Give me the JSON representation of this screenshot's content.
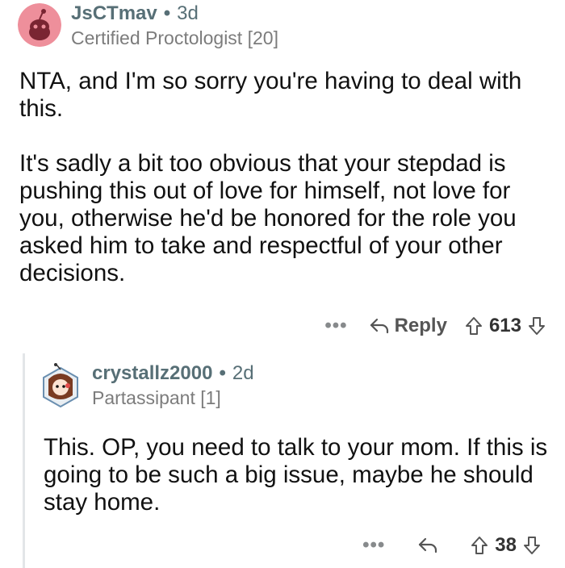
{
  "comments": [
    {
      "username": "JsCTmav",
      "age": "3d",
      "flair": "Certified Proctologist [20]",
      "paragraphs": [
        "NTA, and I'm so sorry you're having to deal with this.",
        "It's sadly a bit too obvious that your stepdad is pushing this out of love for himself, not love for you, otherwise he'd be honored for the role you asked him to take and respectful of your other decisions."
      ],
      "reply_label": "Reply",
      "score": "613"
    },
    {
      "username": "crystallz2000",
      "age": "2d",
      "flair": "Partassipant [1]",
      "paragraphs": [
        "This. OP, you need to talk to your mom. If this is going to be such a big issue, maybe he should stay home."
      ],
      "score": "38"
    }
  ],
  "separator": "•",
  "more_label": "•••",
  "colors": {
    "meta": "#576f76",
    "avatar1": "#ee8f9b",
    "thread_line": "#e3e6e8"
  }
}
